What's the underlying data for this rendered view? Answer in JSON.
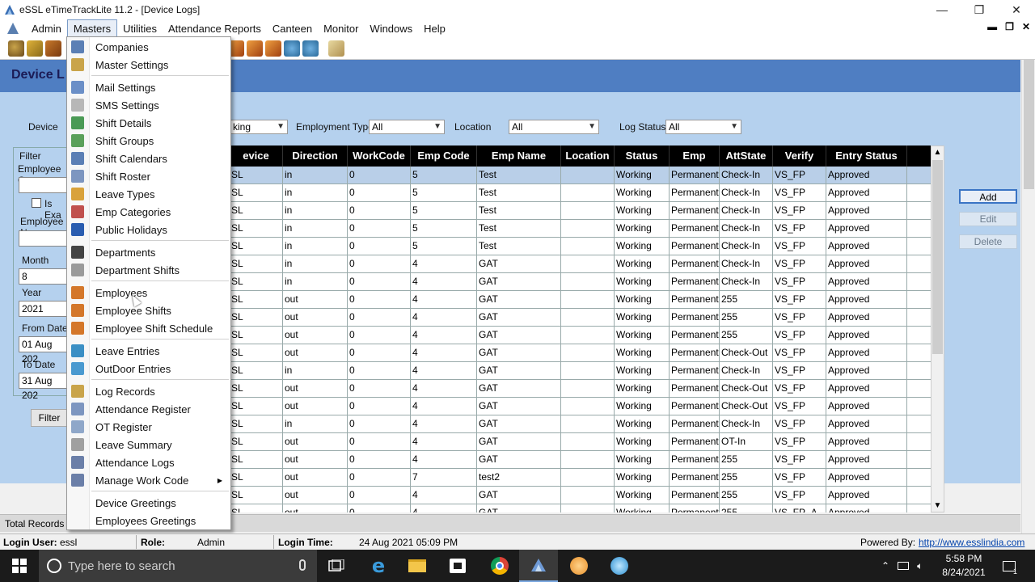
{
  "window": {
    "title": "eSSL eTimeTrackLite 11.2 - [Device Logs]",
    "controls": [
      "—",
      "❐",
      "✕"
    ]
  },
  "menubar": {
    "items": [
      "Admin",
      "Masters",
      "Utilities",
      "Attendance Reports",
      "Canteen",
      "Monitor",
      "Windows",
      "Help"
    ],
    "active": "Masters",
    "mdi_controls": [
      "▬",
      "❐",
      "✕"
    ]
  },
  "toolbar": {
    "icons": [
      "users-icon",
      "key-icon",
      "lock-icon",
      "tool-1-icon",
      "tool-2-icon",
      "tool-3-icon",
      "globe-icon",
      "globe2-icon",
      "folder-icon"
    ]
  },
  "form": {
    "title": "Device L",
    "filters": {
      "device_label": "Device",
      "working_value": "king",
      "employment_type_label": "Employment Type",
      "employment_type_value": "All",
      "location_label": "Location",
      "location_value": "All",
      "log_status_label": "Log Status",
      "log_status_value": "All"
    },
    "filter_panel": {
      "group_label": "Filter",
      "employee_code_label": "Employee Co",
      "is_exact_label": "Is Exa",
      "employee_name_label": "Employee N",
      "month_label": "Month",
      "month_value": "8",
      "year_label": "Year",
      "year_value": "2021",
      "from_date_label": "From Date",
      "from_date_value": "01 Aug 202",
      "to_date_label": "To Date",
      "to_date_value": "31 Aug 202"
    },
    "filter_button": "Filter",
    "total_records_label": "Total Records :",
    "side_buttons": {
      "add": "Add",
      "edit": "Edit",
      "delete": "Delete"
    }
  },
  "grid": {
    "columns": [
      "evice",
      "Direction",
      "WorkCode",
      "Emp Code",
      "Emp Name",
      "Location",
      "Status",
      "Emp",
      "AttState",
      "Verify",
      "Entry Status"
    ],
    "rows": [
      [
        "SL",
        "in",
        "0",
        "5",
        "Test",
        "",
        "Working",
        "Permanent",
        "Check-In",
        "VS_FP",
        "Approved"
      ],
      [
        "SL",
        "in",
        "0",
        "5",
        "Test",
        "",
        "Working",
        "Permanent",
        "Check-In",
        "VS_FP",
        "Approved"
      ],
      [
        "SL",
        "in",
        "0",
        "5",
        "Test",
        "",
        "Working",
        "Permanent",
        "Check-In",
        "VS_FP",
        "Approved"
      ],
      [
        "SL",
        "in",
        "0",
        "5",
        "Test",
        "",
        "Working",
        "Permanent",
        "Check-In",
        "VS_FP",
        "Approved"
      ],
      [
        "SL",
        "in",
        "0",
        "5",
        "Test",
        "",
        "Working",
        "Permanent",
        "Check-In",
        "VS_FP",
        "Approved"
      ],
      [
        "SL",
        "in",
        "0",
        "4",
        "GAT",
        "",
        "Working",
        "Permanent",
        "Check-In",
        "VS_FP",
        "Approved"
      ],
      [
        "SL",
        "in",
        "0",
        "4",
        "GAT",
        "",
        "Working",
        "Permanent",
        "Check-In",
        "VS_FP",
        "Approved"
      ],
      [
        "SL",
        "out",
        "0",
        "4",
        "GAT",
        "",
        "Working",
        "Permanent",
        "255",
        "VS_FP",
        "Approved"
      ],
      [
        "SL",
        "out",
        "0",
        "4",
        "GAT",
        "",
        "Working",
        "Permanent",
        "255",
        "VS_FP",
        "Approved"
      ],
      [
        "SL",
        "out",
        "0",
        "4",
        "GAT",
        "",
        "Working",
        "Permanent",
        "255",
        "VS_FP",
        "Approved"
      ],
      [
        "SL",
        "out",
        "0",
        "4",
        "GAT",
        "",
        "Working",
        "Permanent",
        "Check-Out",
        "VS_FP",
        "Approved"
      ],
      [
        "SL",
        "in",
        "0",
        "4",
        "GAT",
        "",
        "Working",
        "Permanent",
        "Check-In",
        "VS_FP",
        "Approved"
      ],
      [
        "SL",
        "out",
        "0",
        "4",
        "GAT",
        "",
        "Working",
        "Permanent",
        "Check-Out",
        "VS_FP",
        "Approved"
      ],
      [
        "SL",
        "out",
        "0",
        "4",
        "GAT",
        "",
        "Working",
        "Permanent",
        "Check-Out",
        "VS_FP",
        "Approved"
      ],
      [
        "SL",
        "in",
        "0",
        "4",
        "GAT",
        "",
        "Working",
        "Permanent",
        "Check-In",
        "VS_FP",
        "Approved"
      ],
      [
        "SL",
        "out",
        "0",
        "4",
        "GAT",
        "",
        "Working",
        "Permanent",
        "OT-In",
        "VS_FP",
        "Approved"
      ],
      [
        "SL",
        "out",
        "0",
        "4",
        "GAT",
        "",
        "Working",
        "Permanent",
        "255",
        "VS_FP",
        "Approved"
      ],
      [
        "SL",
        "out",
        "0",
        "7",
        "test2",
        "",
        "Working",
        "Permanent",
        "255",
        "VS_FP",
        "Approved"
      ],
      [
        "SL",
        "out",
        "0",
        "4",
        "GAT",
        "",
        "Working",
        "Permanent",
        "255",
        "VS_FP",
        "Approved"
      ],
      [
        "SL",
        "out",
        "0",
        "4",
        "GAT",
        "",
        "Working",
        "Permanent",
        "255",
        "VS_FP_A",
        "Approved"
      ]
    ]
  },
  "masters_menu": {
    "items": [
      {
        "label": "Companies",
        "icon": "building-icon",
        "color": "#5b7fb5"
      },
      {
        "label": "Master Settings",
        "icon": "settings-window-icon",
        "color": "#c9a44a"
      },
      {
        "sep": true
      },
      {
        "label": "Mail Settings",
        "icon": "mail-icon",
        "color": "#6b8fc7"
      },
      {
        "label": "SMS Settings",
        "icon": "sms-icon",
        "color": "#b7b7b7"
      },
      {
        "label": "Shift Details",
        "icon": "shift-details-icon",
        "color": "#4a9a55"
      },
      {
        "label": "Shift Groups",
        "icon": "shift-groups-icon",
        "color": "#5aa05a"
      },
      {
        "label": "Shift Calendars",
        "icon": "calendar-icon",
        "color": "#5b7fb5"
      },
      {
        "label": "Shift Roster",
        "icon": "roster-icon",
        "color": "#7d96c0"
      },
      {
        "label": "Leave Types",
        "icon": "leave-types-icon",
        "color": "#d9a23b"
      },
      {
        "label": "Emp Categories",
        "icon": "categories-icon",
        "color": "#c0504d"
      },
      {
        "label": "Public Holidays",
        "icon": "holidays-icon",
        "color": "#2a5db0"
      },
      {
        "sep": true
      },
      {
        "label": "Departments",
        "icon": "departments-icon",
        "color": "#444444"
      },
      {
        "label": "Department Shifts",
        "icon": "department-shifts-icon",
        "color": "#9a9a9a"
      },
      {
        "sep": true
      },
      {
        "label": "Employees",
        "icon": "employees-icon",
        "color": "#d4772a"
      },
      {
        "label": "Employee Shifts",
        "icon": "employee-shifts-icon",
        "color": "#d4772a"
      },
      {
        "label": "Employee Shift Schedule",
        "icon": "shift-schedule-icon",
        "color": "#d4772a"
      },
      {
        "sep": true
      },
      {
        "label": "Leave Entries",
        "icon": "leave-entries-icon",
        "color": "#3b8fc4"
      },
      {
        "label": "OutDoor Entries",
        "icon": "outdoor-entries-icon",
        "color": "#4a9ad0"
      },
      {
        "sep": true
      },
      {
        "label": "Log Records",
        "icon": "log-records-icon",
        "color": "#c9a44a"
      },
      {
        "label": "Attendance Register",
        "icon": "attendance-register-icon",
        "color": "#7d96c0"
      },
      {
        "label": "OT Register",
        "icon": "ot-register-icon",
        "color": "#8fa7c9"
      },
      {
        "label": "Leave Summary",
        "icon": "leave-summary-icon",
        "color": "#a0a0a0"
      },
      {
        "label": "Attendance Logs",
        "icon": "attendance-logs-icon",
        "color": "#6b7fa8"
      },
      {
        "label": "Manage Work Code",
        "icon": "work-code-icon",
        "color": "#6b7fa8",
        "submenu": true
      },
      {
        "sep": true
      },
      {
        "label": "Device Greetings",
        "icon": "",
        "color": ""
      },
      {
        "label": "Employees Greetings",
        "icon": "",
        "color": ""
      }
    ]
  },
  "statusbar": {
    "login_user_label": "Login User:",
    "login_user_value": "essl",
    "role_label": "Role:",
    "role_value": "Admin",
    "login_time_label": "Login Time:",
    "login_time_value": "24 Aug 2021 05:09 PM",
    "powered_by_label": "Powered By:",
    "powered_by_link": "http://www.esslindia.com"
  },
  "taskbar": {
    "search_placeholder": "Type here to search",
    "time": "5:58 PM",
    "date": "8/24/2021",
    "apps": [
      "task-view-icon",
      "edge-icon",
      "file-explorer-icon",
      "store-icon",
      "chrome-icon",
      "etimetrack-icon",
      "app-orange-icon",
      "app-blue-icon"
    ],
    "tray_icons": [
      "up-arrow-icon",
      "network-icon",
      "volume-icon"
    ],
    "notification_count": "1"
  },
  "colors": {
    "header_blue": "#4f7ec2",
    "form_bg": "#b5d1ee",
    "selected_row": "#b9cfe8",
    "grid_header": "#000000"
  }
}
